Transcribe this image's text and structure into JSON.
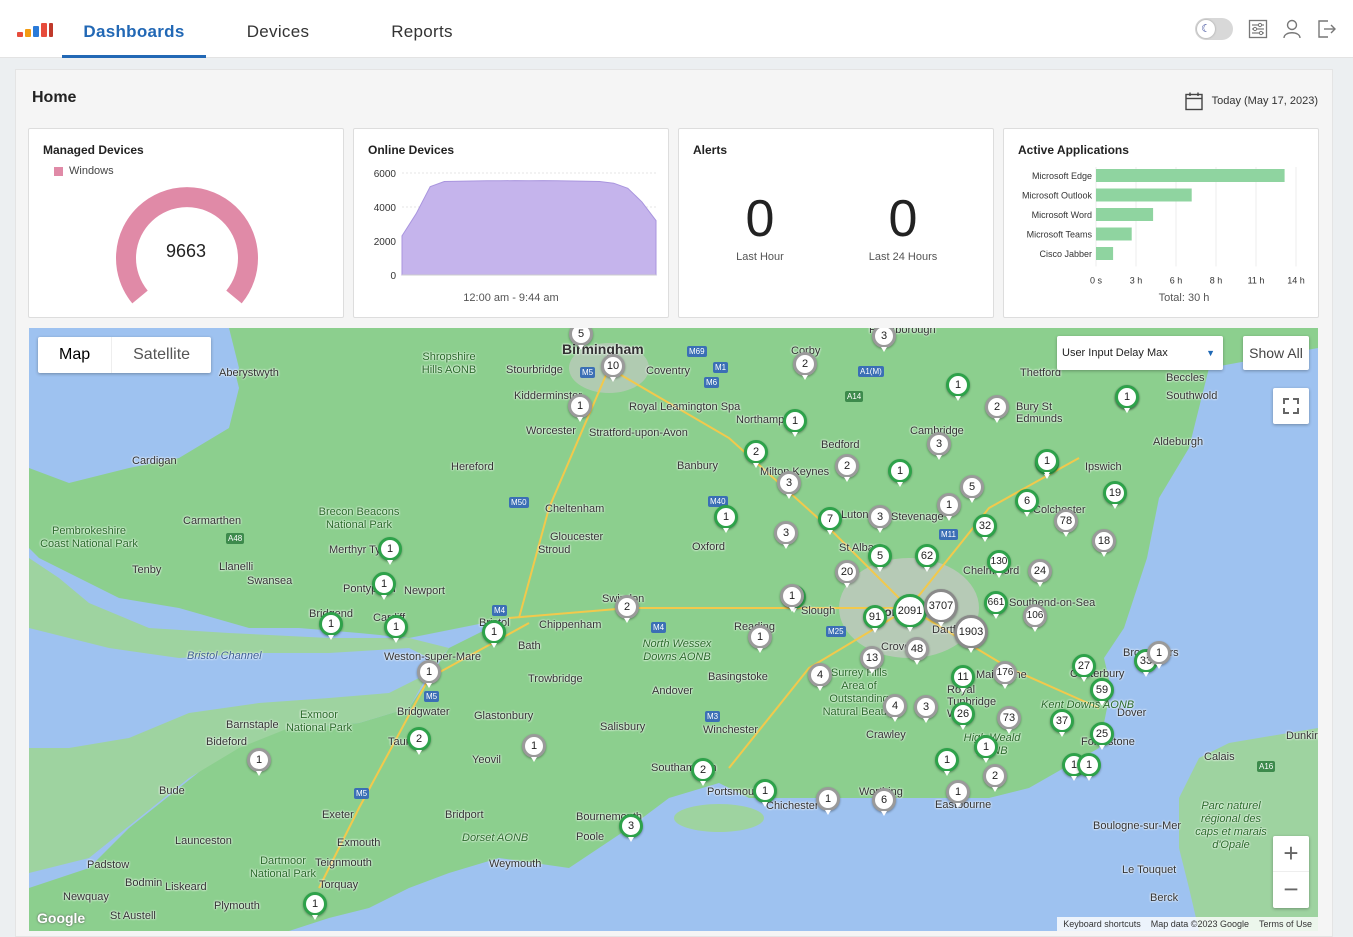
{
  "nav": {
    "tabs": [
      {
        "label": "Dashboards",
        "active": true
      },
      {
        "label": "Devices",
        "active": false
      },
      {
        "label": "Reports",
        "active": false
      }
    ],
    "icons": [
      "theme-toggle-moon-icon",
      "settings-sliders-icon",
      "user-icon",
      "logout-icon"
    ]
  },
  "page": {
    "title": "Home",
    "date": "Today (May 17, 2023)"
  },
  "managed_devices": {
    "title": "Managed Devices",
    "legend": "Windows",
    "value": "9663",
    "color": "#e08aa7"
  },
  "online_devices": {
    "title": "Online Devices",
    "xlabel": "12:00 am - 9:44 am",
    "color": "#c5b4ec"
  },
  "alerts": {
    "title": "Alerts",
    "last_hour": "0",
    "last_hour_label": "Last Hour",
    "last_24": "0",
    "last_24_label": "Last 24 Hours"
  },
  "active_apps": {
    "title": "Active Applications",
    "total": "Total: 30 h",
    "color": "#8fd4a0"
  },
  "chart_data": [
    {
      "type": "area",
      "title": "Online Devices",
      "xlabel": "12:00 am - 9:44 am",
      "ylim": [
        0,
        6000
      ],
      "yticks": [
        "6000",
        "4000",
        "2000",
        "0"
      ],
      "y": [
        2300,
        3600,
        5200,
        5500,
        5520,
        5530,
        5540,
        5540,
        5550,
        5540,
        5550,
        5540,
        5530,
        5520,
        5500,
        5400,
        5100,
        4300,
        3200
      ]
    },
    {
      "type": "bar",
      "title": "Active Applications",
      "categories": [
        "Microsoft Edge",
        "Microsoft Outlook",
        "Microsoft Word",
        "Microsoft Teams",
        "Cisco Jabber"
      ],
      "values": [
        13.2,
        6.7,
        4,
        2.5,
        1.2
      ],
      "xticks": [
        "0 s",
        "3 h",
        "6 h",
        "8 h",
        "11 h",
        "14 h"
      ],
      "xlim": [
        0,
        14
      ],
      "xlabel": "Total: 30 h"
    }
  ],
  "map": {
    "toggle": [
      "Map",
      "Satellite"
    ],
    "select": "User Input Delay Max",
    "show_all": "Show All",
    "zoom_in": "+",
    "zoom_out": "−",
    "google": "Google",
    "attribution": [
      "Keyboard shortcuts",
      "Map data ©2023 Google",
      "Terms of Use"
    ],
    "places": [
      "Birmingham",
      "Coventry",
      "Stourbridge",
      "Kidderminster",
      "Royal Leamington Spa",
      "Worcester",
      "Stratford-upon-Avon",
      "Northampton",
      "Bedford",
      "Cambridge",
      "Hereford",
      "Banbury",
      "Milton Keynes",
      "Ipswich",
      "Cheltenham",
      "Gloucester",
      "Stroud",
      "Oxford",
      "Luton",
      "Stevenage",
      "Colchester",
      "Cardigan",
      "Carmarthen",
      "Llanelli",
      "Swansea",
      "Newport",
      "Cardiff",
      "Bridgend",
      "Pontypridd",
      "Merthyr Tydfil",
      "Tenby",
      "Pembrokeshire Coast National Park",
      "Brecon Beacons National Park",
      "Shropshire Hills AONB",
      "Aberystwyth",
      "Bristol",
      "Bath",
      "Chippenham",
      "Swindon",
      "Reading",
      "Slough",
      "London",
      "St Albans",
      "Chelmsford",
      "Southend-on-Sea",
      "Dartford",
      "Weston-super-Mare",
      "Bristol Channel",
      "Trowbridge",
      "North Wessex Downs AONB",
      "Basingstoke",
      "Surrey Hills Area of Outstanding Natural Beauty",
      "Crawley",
      "Royal Tunbridge Wells",
      "Maidstone",
      "Canterbury",
      "Broadstairs",
      "Dover",
      "Folkestone",
      "Kent Downs AONB",
      "High Weald AONB",
      "Exmoor National Park",
      "Barnstaple",
      "Bideford",
      "Bridgwater",
      "Glastonbury",
      "Taunton",
      "Salisbury",
      "Winchester",
      "Andover",
      "Yeovil",
      "Southampton",
      "Portsmouth",
      "Chichester",
      "Worthing",
      "Eastbourne",
      "Bournemouth",
      "Poole",
      "Bridport",
      "Dorset AONB",
      "Exeter",
      "Exmouth",
      "Weymouth",
      "Bude",
      "Launceston",
      "Dartmoor National Park",
      "Teignmouth",
      "Torquay",
      "Padstow",
      "Bodmin",
      "Liskeard",
      "Newquay",
      "Plymouth",
      "St Austell",
      "Thetford",
      "Beccles",
      "Southwold",
      "Bury St Edmunds",
      "Aldeburgh",
      "Peterborough",
      "Corby",
      "Calais",
      "Boulogne-sur-Mer",
      "Dunkirk",
      "Parc naturel régional des caps et marais d'Opale",
      "Le Touquet",
      "Berck",
      "Crovdon"
    ],
    "markers": [
      {
        "v": "5",
        "s": "gray"
      },
      {
        "v": "10",
        "s": "gray"
      },
      {
        "v": "3",
        "s": "gray"
      },
      {
        "v": "2",
        "s": "gray"
      },
      {
        "v": "1",
        "s": "gray"
      },
      {
        "v": "1",
        "s": "green"
      },
      {
        "v": "2",
        "s": "gray"
      },
      {
        "v": "1",
        "s": "green"
      },
      {
        "v": "2",
        "s": "green"
      },
      {
        "v": "3",
        "s": "gray"
      },
      {
        "v": "1",
        "s": "green"
      },
      {
        "v": "2",
        "s": "gray"
      },
      {
        "v": "3",
        "s": "green"
      },
      {
        "v": "3",
        "s": "gray"
      },
      {
        "v": "1",
        "s": "green"
      },
      {
        "v": "5",
        "s": "gray"
      },
      {
        "v": "1",
        "s": "gray"
      },
      {
        "v": "6",
        "s": "green"
      },
      {
        "v": "19",
        "s": "green"
      },
      {
        "v": "7",
        "s": "green"
      },
      {
        "v": "3",
        "s": "gray"
      },
      {
        "v": "3",
        "s": "gray"
      },
      {
        "v": "32",
        "s": "green"
      },
      {
        "v": "78",
        "s": "gray"
      },
      {
        "v": "2",
        "s": "gray"
      },
      {
        "v": "5",
        "s": "green"
      },
      {
        "v": "62",
        "s": "green"
      },
      {
        "v": "18",
        "s": "gray"
      },
      {
        "v": "130",
        "s": "green"
      },
      {
        "v": "24",
        "s": "gray"
      },
      {
        "v": "20",
        "s": "gray"
      },
      {
        "v": "1",
        "s": "green"
      },
      {
        "v": "1",
        "s": "green"
      },
      {
        "v": "1",
        "s": "green"
      },
      {
        "v": "1",
        "s": "green"
      },
      {
        "v": "1",
        "s": "green"
      },
      {
        "v": "2",
        "s": "gray"
      },
      {
        "v": "4",
        "s": "green"
      },
      {
        "v": "1",
        "s": "gray"
      },
      {
        "v": "2091",
        "s": "green"
      },
      {
        "v": "3707",
        "s": "gray"
      },
      {
        "v": "661",
        "s": "green"
      },
      {
        "v": "106",
        "s": "gray"
      },
      {
        "v": "91",
        "s": "green"
      },
      {
        "v": "1903",
        "s": "gray"
      },
      {
        "v": "1",
        "s": "gray"
      },
      {
        "v": "1",
        "s": "gray"
      },
      {
        "v": "48",
        "s": "gray"
      },
      {
        "v": "13",
        "s": "gray"
      },
      {
        "v": "11",
        "s": "green"
      },
      {
        "v": "176",
        "s": "gray"
      },
      {
        "v": "27",
        "s": "green"
      },
      {
        "v": "33",
        "s": "green"
      },
      {
        "v": "59",
        "s": "green"
      },
      {
        "v": "4",
        "s": "gray"
      },
      {
        "v": "4",
        "s": "gray"
      },
      {
        "v": "3",
        "s": "gray"
      },
      {
        "v": "26",
        "s": "green"
      },
      {
        "v": "73",
        "s": "gray"
      },
      {
        "v": "37",
        "s": "green"
      },
      {
        "v": "25",
        "s": "green"
      },
      {
        "v": "2",
        "s": "green"
      },
      {
        "v": "1",
        "s": "gray"
      },
      {
        "v": "1",
        "s": "gray"
      },
      {
        "v": "2",
        "s": "gray"
      },
      {
        "v": "1",
        "s": "green"
      },
      {
        "v": "1",
        "s": "green"
      },
      {
        "v": "2",
        "s": "green"
      },
      {
        "v": "1",
        "s": "green"
      },
      {
        "v": "1",
        "s": "green"
      },
      {
        "v": "1",
        "s": "gray"
      },
      {
        "v": "6",
        "s": "gray"
      },
      {
        "v": "1",
        "s": "gray"
      },
      {
        "v": "3",
        "s": "green"
      },
      {
        "v": "1",
        "s": "green"
      },
      {
        "v": "1",
        "s": "green"
      },
      {
        "v": "1",
        "s": "green"
      },
      {
        "v": "1",
        "s": "green"
      },
      {
        "v": "1",
        "s": "gray"
      }
    ]
  }
}
